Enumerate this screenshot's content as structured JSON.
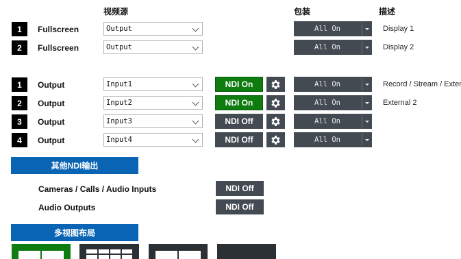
{
  "headers": {
    "video_source": "视频源",
    "package": "包装",
    "description": "描述"
  },
  "display_rows": [
    {
      "num": "1",
      "label": "Fullscreen",
      "source": "Output",
      "package": "All On",
      "description": "Display 1"
    },
    {
      "num": "2",
      "label": "Fullscreen",
      "source": "Output",
      "package": "All On",
      "description": "Display 2"
    }
  ],
  "output_rows": [
    {
      "num": "1",
      "label": "Output",
      "source": "Input1",
      "ndi": "NDI On",
      "ndi_state": "on",
      "package": "All On",
      "description": "Record / Stream / Exter"
    },
    {
      "num": "2",
      "label": "Output",
      "source": "Input2",
      "ndi": "NDI On",
      "ndi_state": "on",
      "package": "All On",
      "description": "External 2"
    },
    {
      "num": "3",
      "label": "Output",
      "source": "Input3",
      "ndi": "NDI Off",
      "ndi_state": "off",
      "package": "All On",
      "description": ""
    },
    {
      "num": "4",
      "label": "Output",
      "source": "Input4",
      "ndi": "NDI Off",
      "ndi_state": "off",
      "package": "All On",
      "description": ""
    }
  ],
  "other_ndi": {
    "title": "其他NDI输出",
    "items": [
      {
        "label": "Cameras / Calls / Audio Inputs",
        "ndi": "NDI Off"
      },
      {
        "label": "Audio Outputs",
        "ndi": "NDI Off"
      }
    ]
  },
  "multiview": {
    "title": "多视图布局",
    "selected_index": 0
  },
  "colors": {
    "accent_blue": "#0a64b4",
    "ndi_on": "#0e7c0e",
    "dark_button": "#434a52"
  },
  "icons": {
    "settings": "gear-icon",
    "dropdown": "chevron-down-icon"
  }
}
